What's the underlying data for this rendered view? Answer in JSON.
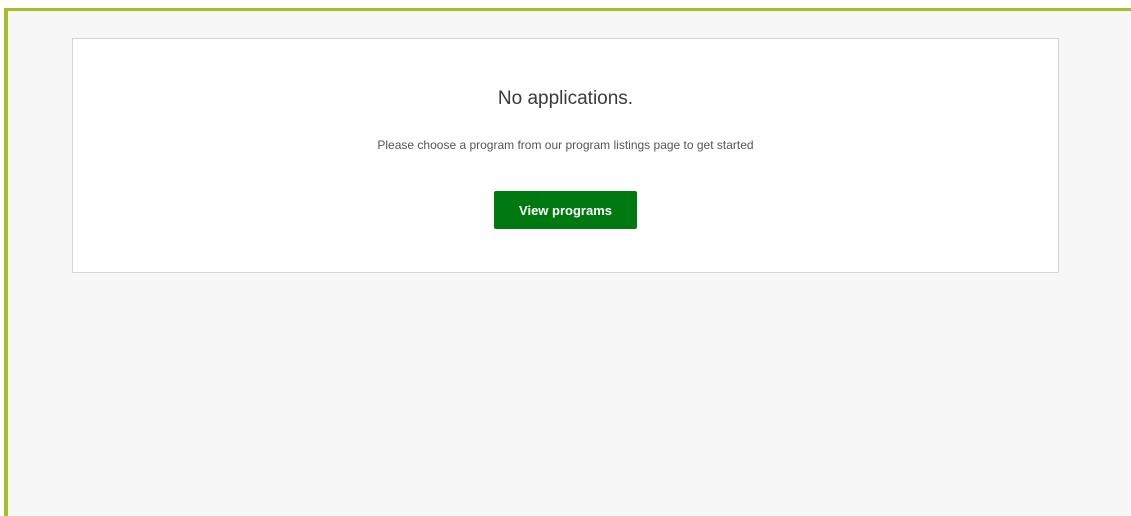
{
  "empty_state": {
    "title": "No applications.",
    "message": "Please choose a program from our program listings page to get started",
    "button_label": "View programs"
  },
  "colors": {
    "accent_border": "#a8bd2a",
    "button_background": "#007a10",
    "page_background": "#f7f7f7",
    "card_background": "#ffffff"
  }
}
